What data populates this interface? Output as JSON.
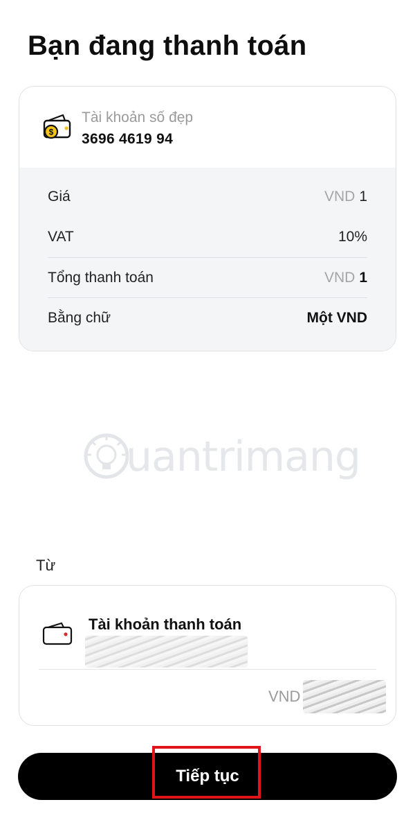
{
  "page": {
    "title": "Bạn đang thanh toán"
  },
  "account": {
    "icon": "money-wallet-icon",
    "name": "Tài khoản số đẹp",
    "number": "3696 4619 94"
  },
  "details": {
    "price": {
      "label": "Giá",
      "currency": "VND",
      "value": "1"
    },
    "vat": {
      "label": "VAT",
      "value": "10%"
    },
    "total": {
      "label": "Tổng thanh toán",
      "currency": "VND",
      "value": "1"
    },
    "in_words": {
      "label": "Bằng chữ",
      "value": "Một VND"
    }
  },
  "watermark": {
    "text": "uantrimang"
  },
  "source": {
    "label": "Từ",
    "icon": "wallet-icon",
    "account_name": "Tài khoản thanh toán",
    "balance_currency": "VND"
  },
  "actions": {
    "continue_label": "Tiếp tục"
  },
  "colors": {
    "primary_button": "#000000",
    "highlight": "#e0141a",
    "panel_bg": "#f4f5f7",
    "coin": "#f2c318"
  }
}
